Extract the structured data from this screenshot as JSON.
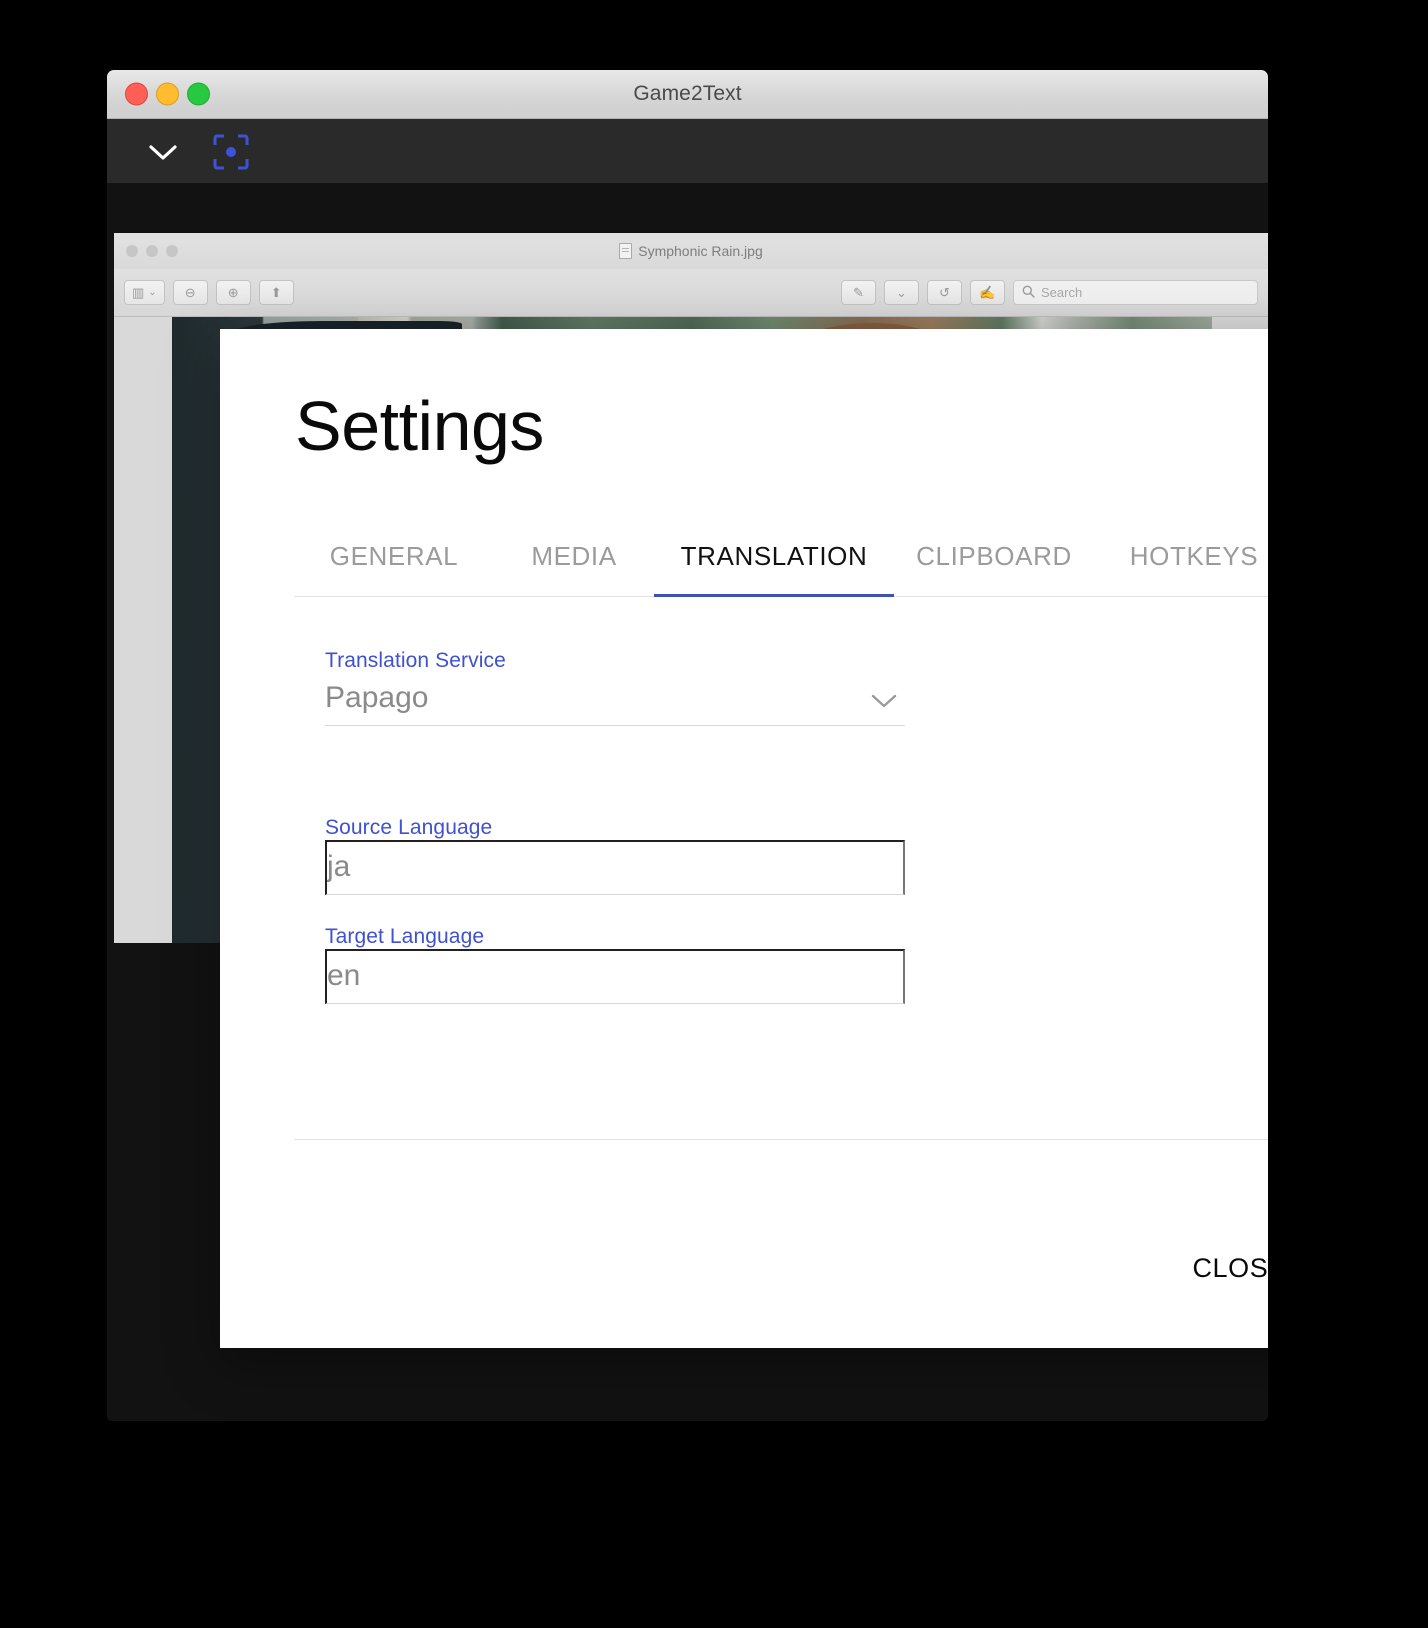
{
  "window": {
    "title": "Game2Text",
    "traffic_lights": [
      "close",
      "minimize",
      "zoom"
    ],
    "toolbar": {
      "dropdown_icon": "chevron-down-icon",
      "capture_icon": "capture-target-icon"
    }
  },
  "preview": {
    "title": "Symphonic Rain.jpg",
    "toolbar": {
      "sidebar_label": "▥",
      "sidebar_caret": "⌄",
      "zoom_out": "⊖",
      "zoom_in": "⊕",
      "share": "⬆",
      "markup": "✎",
      "markup_caret": "⌄",
      "rotate": "↺",
      "annotate": "✍",
      "search_placeholder": "Search",
      "search_value": ""
    }
  },
  "settings": {
    "heading": "Settings",
    "tabs": [
      {
        "label": "GENERAL",
        "active": false
      },
      {
        "label": "MEDIA",
        "active": false
      },
      {
        "label": "TRANSLATION",
        "active": true
      },
      {
        "label": "CLIPBOARD",
        "active": false
      },
      {
        "label": "HOTKEYS",
        "active": false
      }
    ],
    "accent_color": "#3f51b5",
    "label_color": "#3f51d0",
    "fields": {
      "translation_service": {
        "label": "Translation Service",
        "value": "Papago",
        "control": "select",
        "chevron_icon": "chevron-down-icon"
      },
      "source_language": {
        "label": "Source Language",
        "value": "ja",
        "placeholder": "",
        "control": "text"
      },
      "target_language": {
        "label": "Target Language",
        "value": "en",
        "placeholder": "",
        "control": "text"
      }
    },
    "close_label": "CLOSE"
  }
}
